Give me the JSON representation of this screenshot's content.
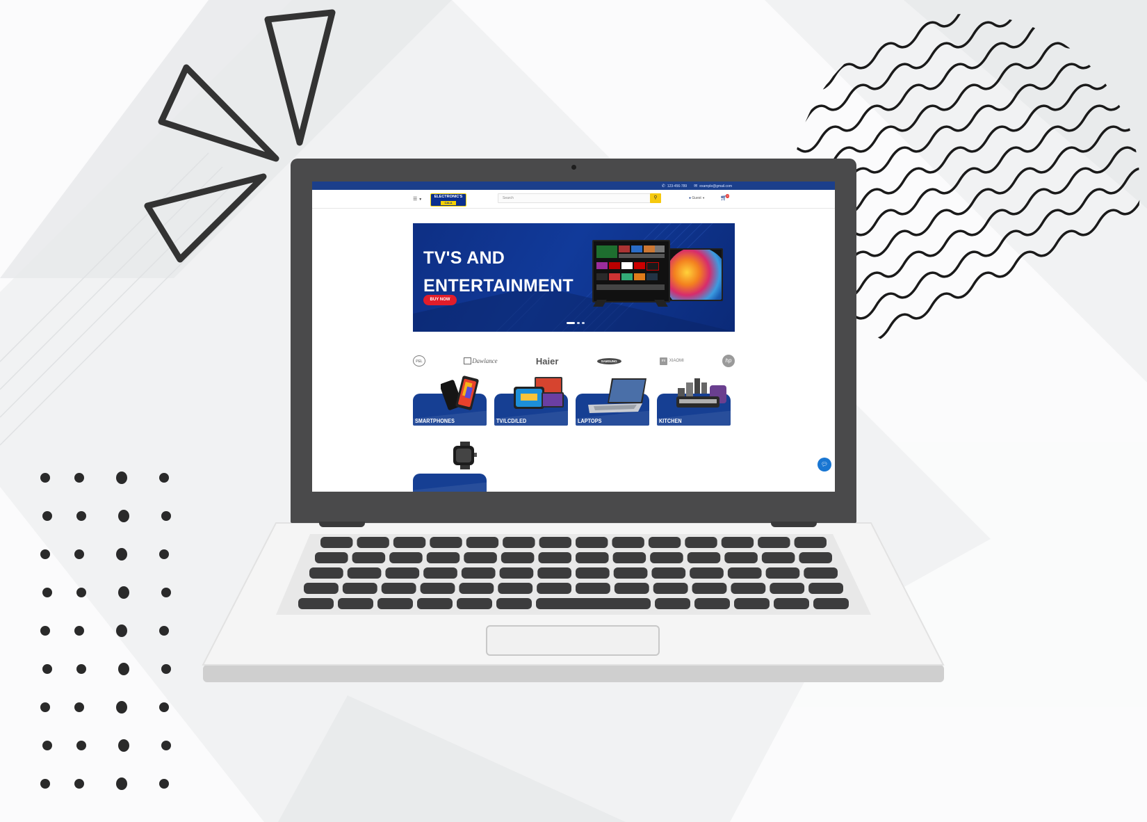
{
  "topbar": {
    "phone": "123-456-789",
    "email": "example@gmail.com"
  },
  "header": {
    "logo_main": "ELECTRONIC'S",
    "logo_sub": "CALA",
    "search_placeholder": "Search",
    "account_label": "Guest",
    "cart_count": "0"
  },
  "hero": {
    "title": "TV'S AND\nENTERTAINMENT",
    "cta": "BUY NOW",
    "slides": 3,
    "active_slide": 1
  },
  "brands": [
    "PEL",
    "Dawlance",
    "Haier",
    "SAMSUNG",
    "XIAOMI",
    "hp"
  ],
  "categories": [
    {
      "label": "SMARTPHONES"
    },
    {
      "label": "TV/LCD/LED"
    },
    {
      "label": "LAPTOPS"
    },
    {
      "label": "KITCHEN"
    }
  ],
  "icons": {
    "menu": "hamburger-icon",
    "search": "search-icon",
    "user": "user-icon",
    "cart": "cart-icon",
    "phone": "phone-icon",
    "email": "envelope-icon",
    "chat": "chat-icon"
  },
  "colors": {
    "brand_blue": "#1b3f8b",
    "search_yellow": "#f6c90e",
    "cta_red": "#e11d2a",
    "category_blue": "#163f93"
  }
}
